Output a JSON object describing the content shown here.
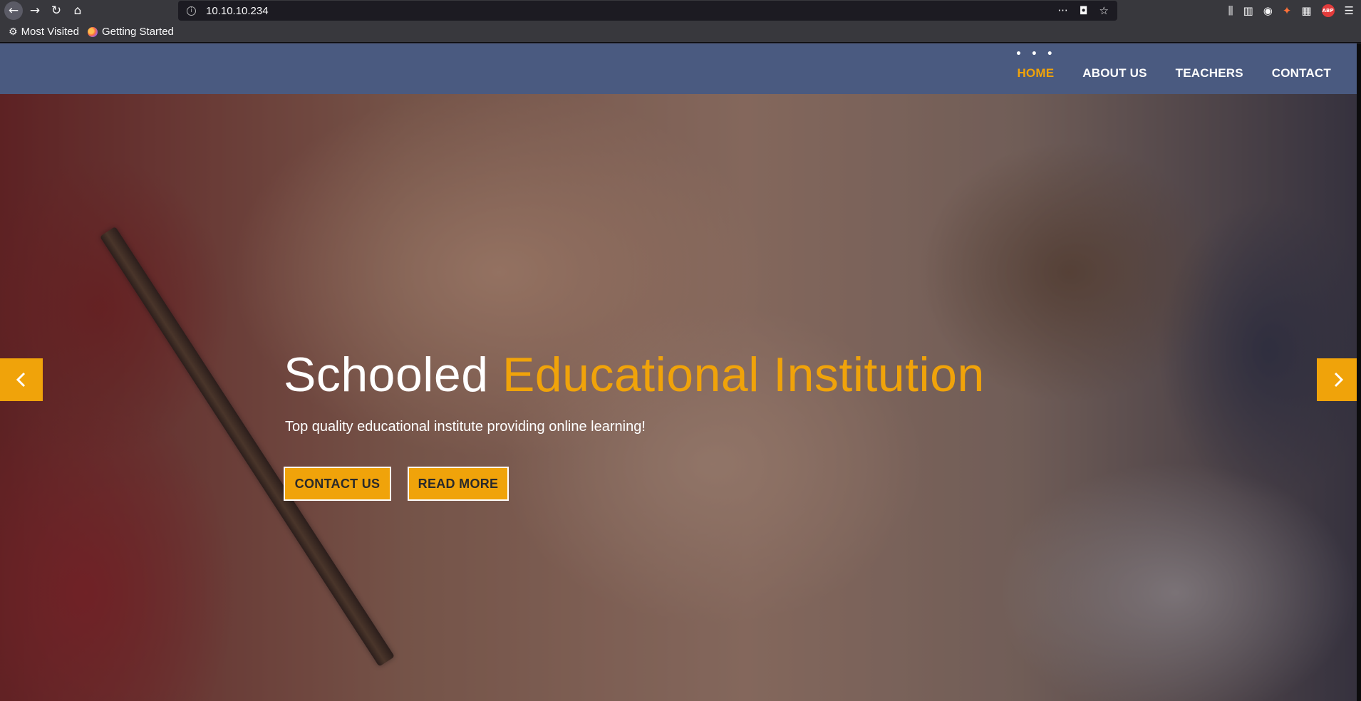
{
  "browser": {
    "url": "10.10.10.234",
    "bookmarks": [
      {
        "label": "Most Visited",
        "icon": "gear-icon"
      },
      {
        "label": "Getting Started",
        "icon": "firefox-icon"
      }
    ],
    "abp_label": "ABP"
  },
  "nav": {
    "items": [
      {
        "label": "HOME",
        "active": true
      },
      {
        "label": "ABOUT US",
        "active": false
      },
      {
        "label": "TEACHERS",
        "active": false
      },
      {
        "label": "CONTACT",
        "active": false
      }
    ],
    "dots": "• • •"
  },
  "hero": {
    "title_plain": "Schooled ",
    "title_accent": "Educational Institution",
    "subtitle": "Top quality educational institute providing online learning!",
    "buttons": {
      "contact": "CONTACT US",
      "read_more": "READ MORE"
    }
  },
  "colors": {
    "accent": "#f0a30a",
    "header_bg": "#4a5a80",
    "browser_bg": "#38383d"
  }
}
